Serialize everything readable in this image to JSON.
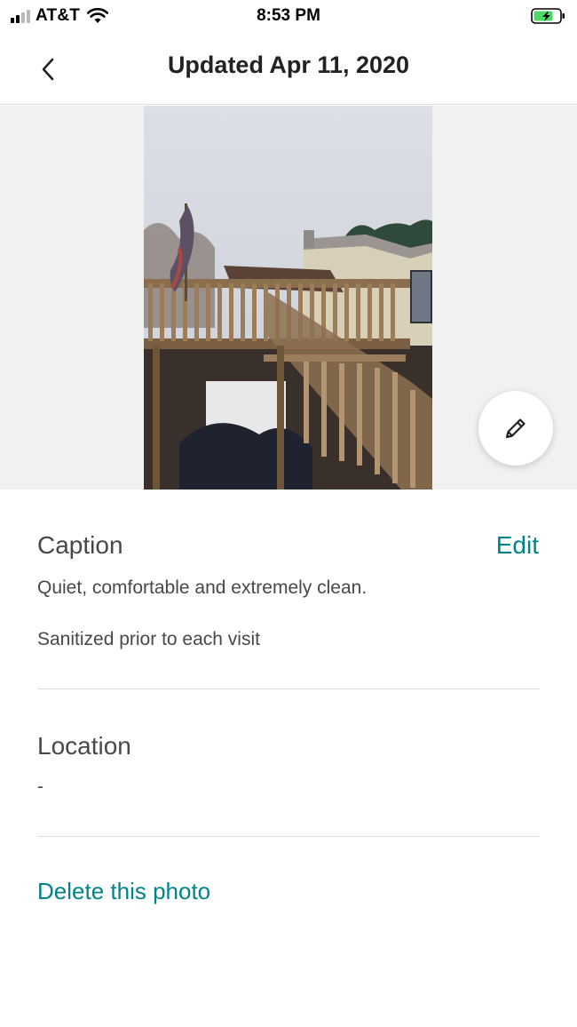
{
  "status_bar": {
    "carrier": "AT&T",
    "time": "8:53 PM",
    "signal_bars_active": 2,
    "signal_bars_total": 4,
    "battery_state": "charging",
    "battery_level": 0.75,
    "battery_color": "#4cd964"
  },
  "header": {
    "title": "Updated Apr 11, 2020",
    "back_icon": "chevron-left-icon"
  },
  "photo": {
    "edit_icon": "pencil-icon"
  },
  "caption": {
    "label": "Caption",
    "edit_label": "Edit",
    "lines": [
      "Quiet, comfortable and extremely clean.",
      "Sanitized prior to each visit"
    ]
  },
  "location": {
    "label": "Location",
    "value": "-"
  },
  "actions": {
    "delete_label": "Delete this photo"
  },
  "colors": {
    "accent": "#008489",
    "text_primary": "#222222",
    "text_secondary": "#484848",
    "divider": "#dddddd"
  }
}
